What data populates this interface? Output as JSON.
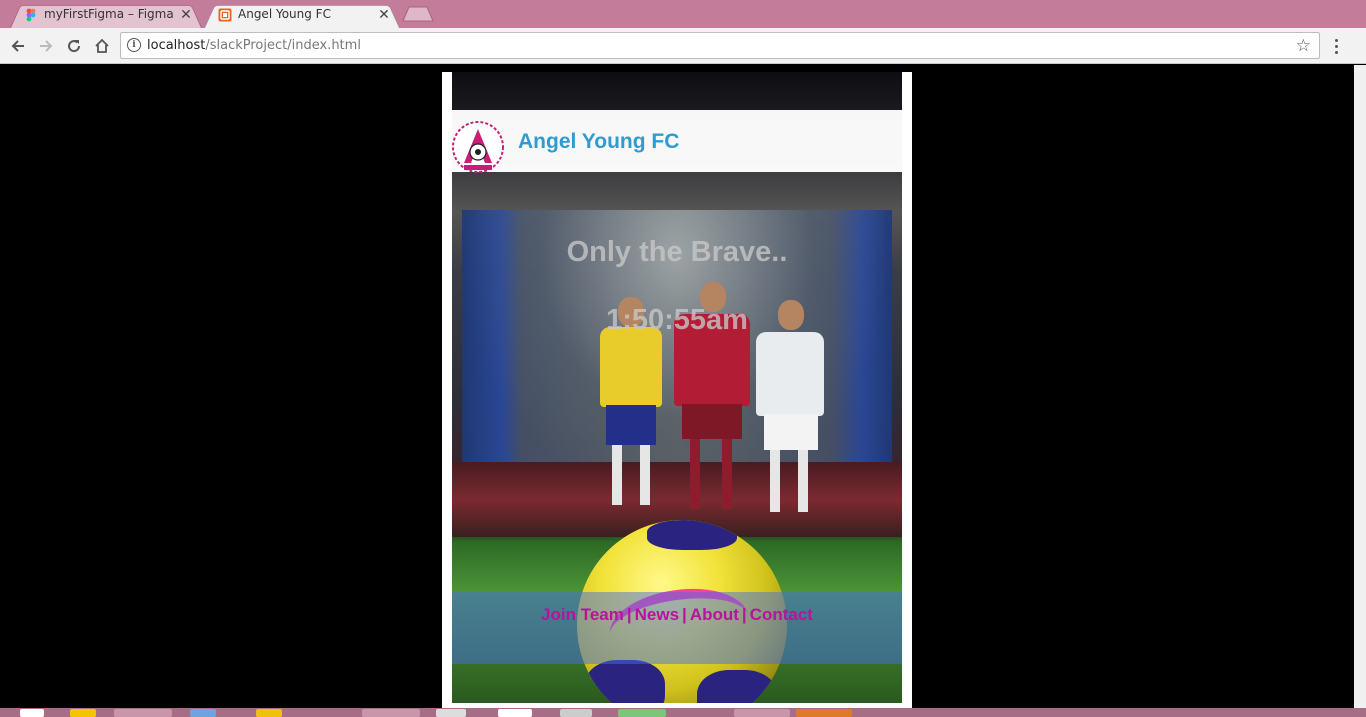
{
  "browser": {
    "tabs": [
      {
        "title": "myFirstFigma – Figma",
        "favicon": "figma-icon"
      },
      {
        "title": "Angel Young FC",
        "favicon": "html-file-icon",
        "active": true
      }
    ],
    "address": {
      "host": "localhost",
      "path": "/slackProject/index.html"
    }
  },
  "site": {
    "club_name": "Angel Young FC",
    "logo_text": "ANGEL YOUNG",
    "slogan": "Only the Brave..",
    "clock": "1:50:55am",
    "nav": [
      {
        "label": "Join Team"
      },
      {
        "label": "News"
      },
      {
        "label": "About"
      },
      {
        "label": "Contact"
      }
    ],
    "nav_separator": "|"
  },
  "colors": {
    "tabstrip": "#c37d9a",
    "club_name": "#2f9bd1",
    "nav_link": "#b8129f",
    "logo_ring": "#c81e78"
  }
}
